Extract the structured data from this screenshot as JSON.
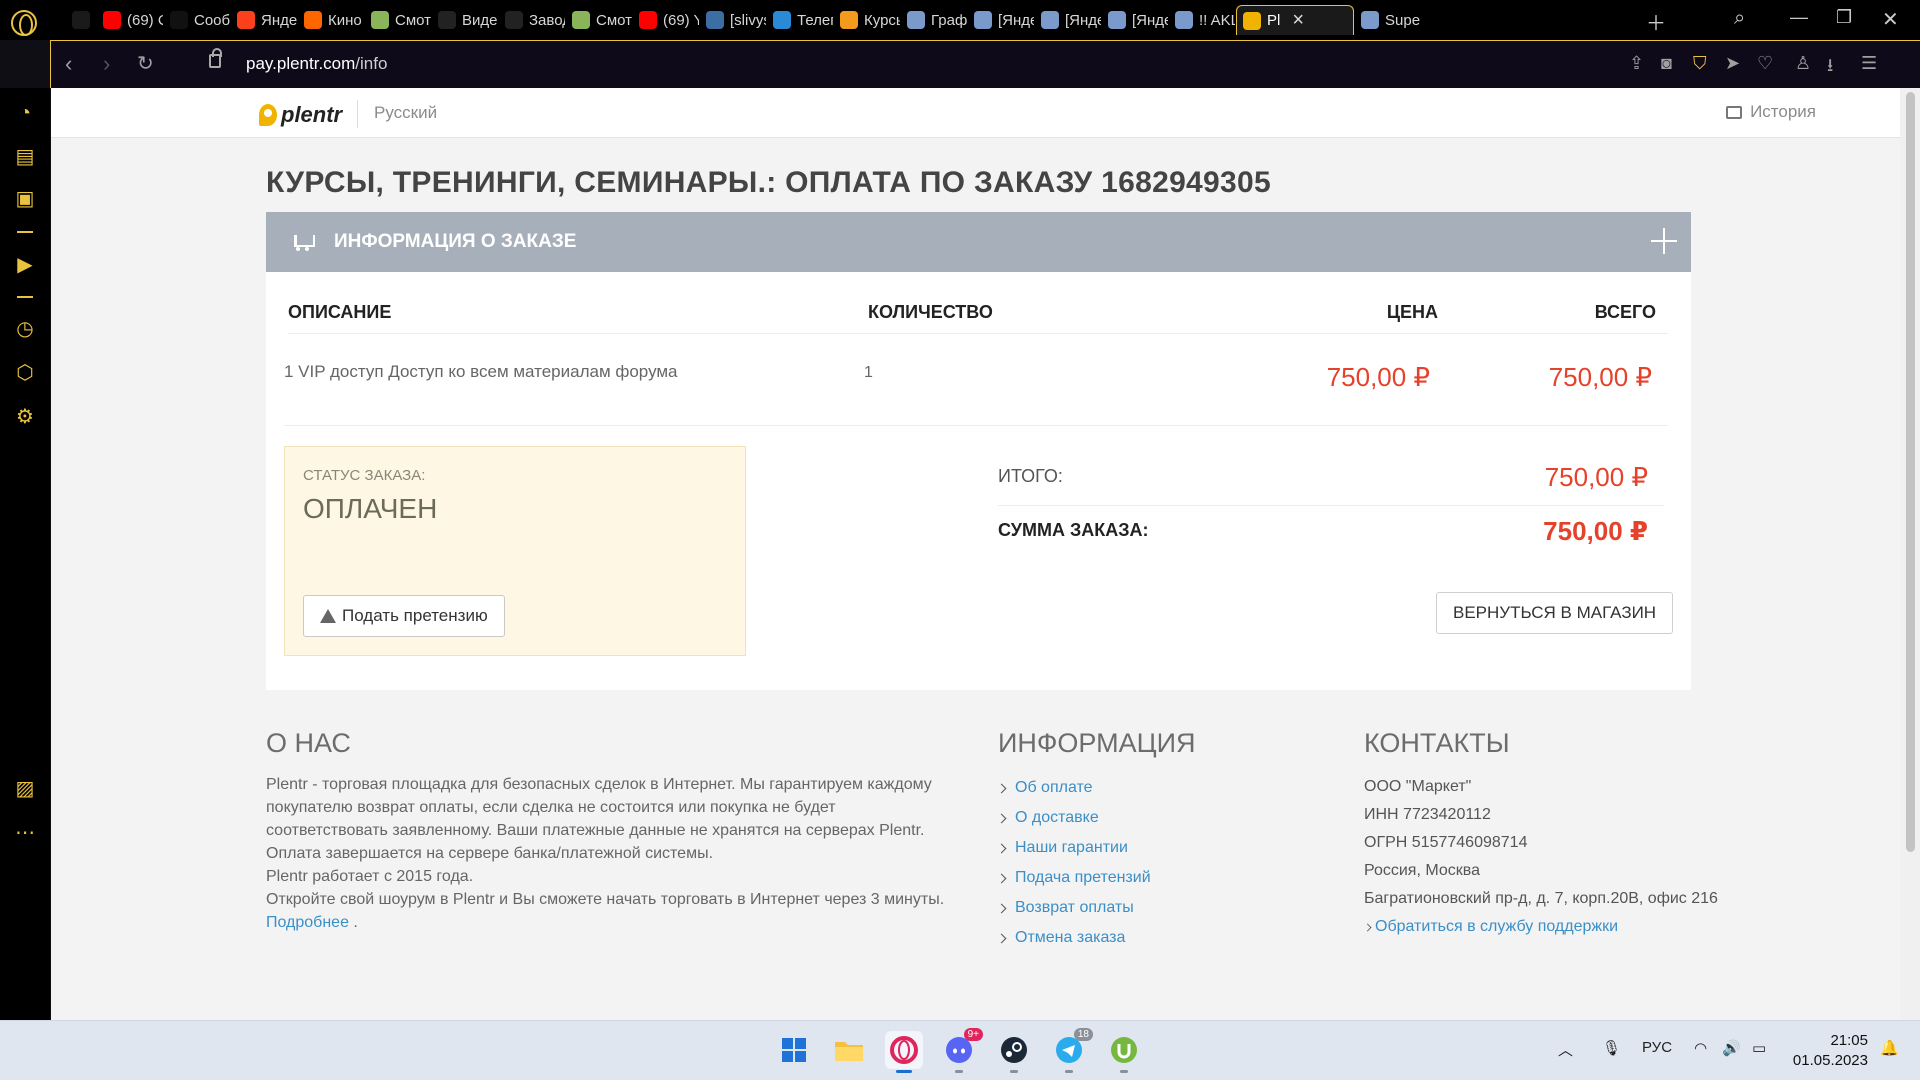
{
  "browser": {
    "tabs": [
      {
        "label": "",
        "icon": "gamepad-icon",
        "color": "#1a1a1a"
      },
      {
        "label": "(69) С",
        "icon": "youtube-icon",
        "color": "#ff0000"
      },
      {
        "label": "Сооб",
        "icon": "tiktok-icon",
        "color": "#111111"
      },
      {
        "label": "Яндек",
        "icon": "yandex-icon",
        "color": "#fc3f1d"
      },
      {
        "label": "Кино",
        "icon": "kinopoisk-icon",
        "color": "#ff6600"
      },
      {
        "label": "Смот",
        "icon": "site-icon",
        "color": "#8ab45a"
      },
      {
        "label": "Видео",
        "icon": "r-icon",
        "color": "#222222"
      },
      {
        "label": "Завод",
        "icon": "r-icon",
        "color": "#222222"
      },
      {
        "label": "Смотр",
        "icon": "site-icon",
        "color": "#8ab45a"
      },
      {
        "label": "(69) Y",
        "icon": "youtube-icon",
        "color": "#ff0000"
      },
      {
        "label": "[slivys",
        "icon": "forum-icon",
        "color": "#3a6ea5"
      },
      {
        "label": "Телег",
        "icon": "q-icon",
        "color": "#2a8ad6"
      },
      {
        "label": "Курсы",
        "icon": "cloud-icon",
        "color": "#f29b1d"
      },
      {
        "label": "Граф",
        "icon": "image-icon",
        "color": "#7b9acc"
      },
      {
        "label": "[Янде",
        "icon": "image-icon",
        "color": "#7b9acc"
      },
      {
        "label": "[Янде",
        "icon": "image-icon",
        "color": "#7b9acc"
      },
      {
        "label": "[Янде",
        "icon": "image-icon",
        "color": "#7b9acc"
      },
      {
        "label": "!! AKL",
        "icon": "image-icon",
        "color": "#7b9acc"
      },
      {
        "label": "Pl",
        "icon": "plentr-icon",
        "color": "#f0b400",
        "active": true
      },
      {
        "label": "Super",
        "icon": "image-icon",
        "color": "#7b9acc"
      }
    ],
    "url_domain": "pay.plentr.com",
    "url_path": "/info"
  },
  "site": {
    "logo_text": "plentr",
    "language": "Русский",
    "history_label": "История"
  },
  "order": {
    "title": "КУРСЫ, ТРЕНИНГИ, СЕМИНАРЫ.: ОПЛАТА ПО ЗАКАЗУ 1682949305",
    "panel_title": "ИНФОРМАЦИЯ О ЗАКАЗЕ",
    "columns": {
      "description": "ОПИСАНИЕ",
      "quantity": "КОЛИЧЕСТВО",
      "price": "ЦЕНА",
      "total": "ВСЕГО"
    },
    "items": [
      {
        "description": "1 VIP доступ Доступ ко всем материалам форума",
        "quantity": "1",
        "price": "750,00 ₽",
        "total": "750,00 ₽"
      }
    ],
    "status_label": "СТАТУС ЗАКАЗА:",
    "status_value": "ОПЛАЧЕН",
    "claim_button": "Подать претензию",
    "subtotal_label": "ИТОГО:",
    "subtotal_value": "750,00 ₽",
    "sum_label": "СУММА ЗАКАЗА:",
    "sum_value": "750,00 ₽",
    "return_button": "ВЕРНУТЬСЯ В МАГАЗИН"
  },
  "footer": {
    "about_title": "О НАС",
    "about_text": "Plentr - торговая площадка для безопасных сделок в Интернет. Мы гарантируем каждому покупателю возврат оплаты, если сделка не состоится или покупка не будет соответствовать заявленному. Ваши платежные данные не хранятся на серверах Plentr. Оплата завершается на сервере банка/платежной системы.",
    "about_since": "Plentr работает с 2015 года.",
    "about_cta": "Откройте свой шоурум в Plentr и Вы сможете начать торговать в Интернет через 3 минуты.",
    "about_more": "Подробнее",
    "info_title": "ИНФОРМАЦИЯ",
    "info_links": [
      "Об оплате",
      "О доставке",
      "Наши гарантии",
      "Подача претензий",
      "Возврат оплаты",
      "Отмена заказа"
    ],
    "contacts_title": "КОНТАКТЫ",
    "contacts": [
      "ООО \"Маркет\"",
      "ИНН 7723420112",
      "ОГРН 5157746098714",
      "Россия, Москва",
      "Багратионовский пр-д, д. 7, корп.20В, офис 216"
    ],
    "support_link": "Обратиться в службу поддержки"
  },
  "taskbar": {
    "discord_badge": "9+",
    "telegram_badge": "18",
    "language": "РУС",
    "time": "21:05",
    "date": "01.05.2023"
  }
}
